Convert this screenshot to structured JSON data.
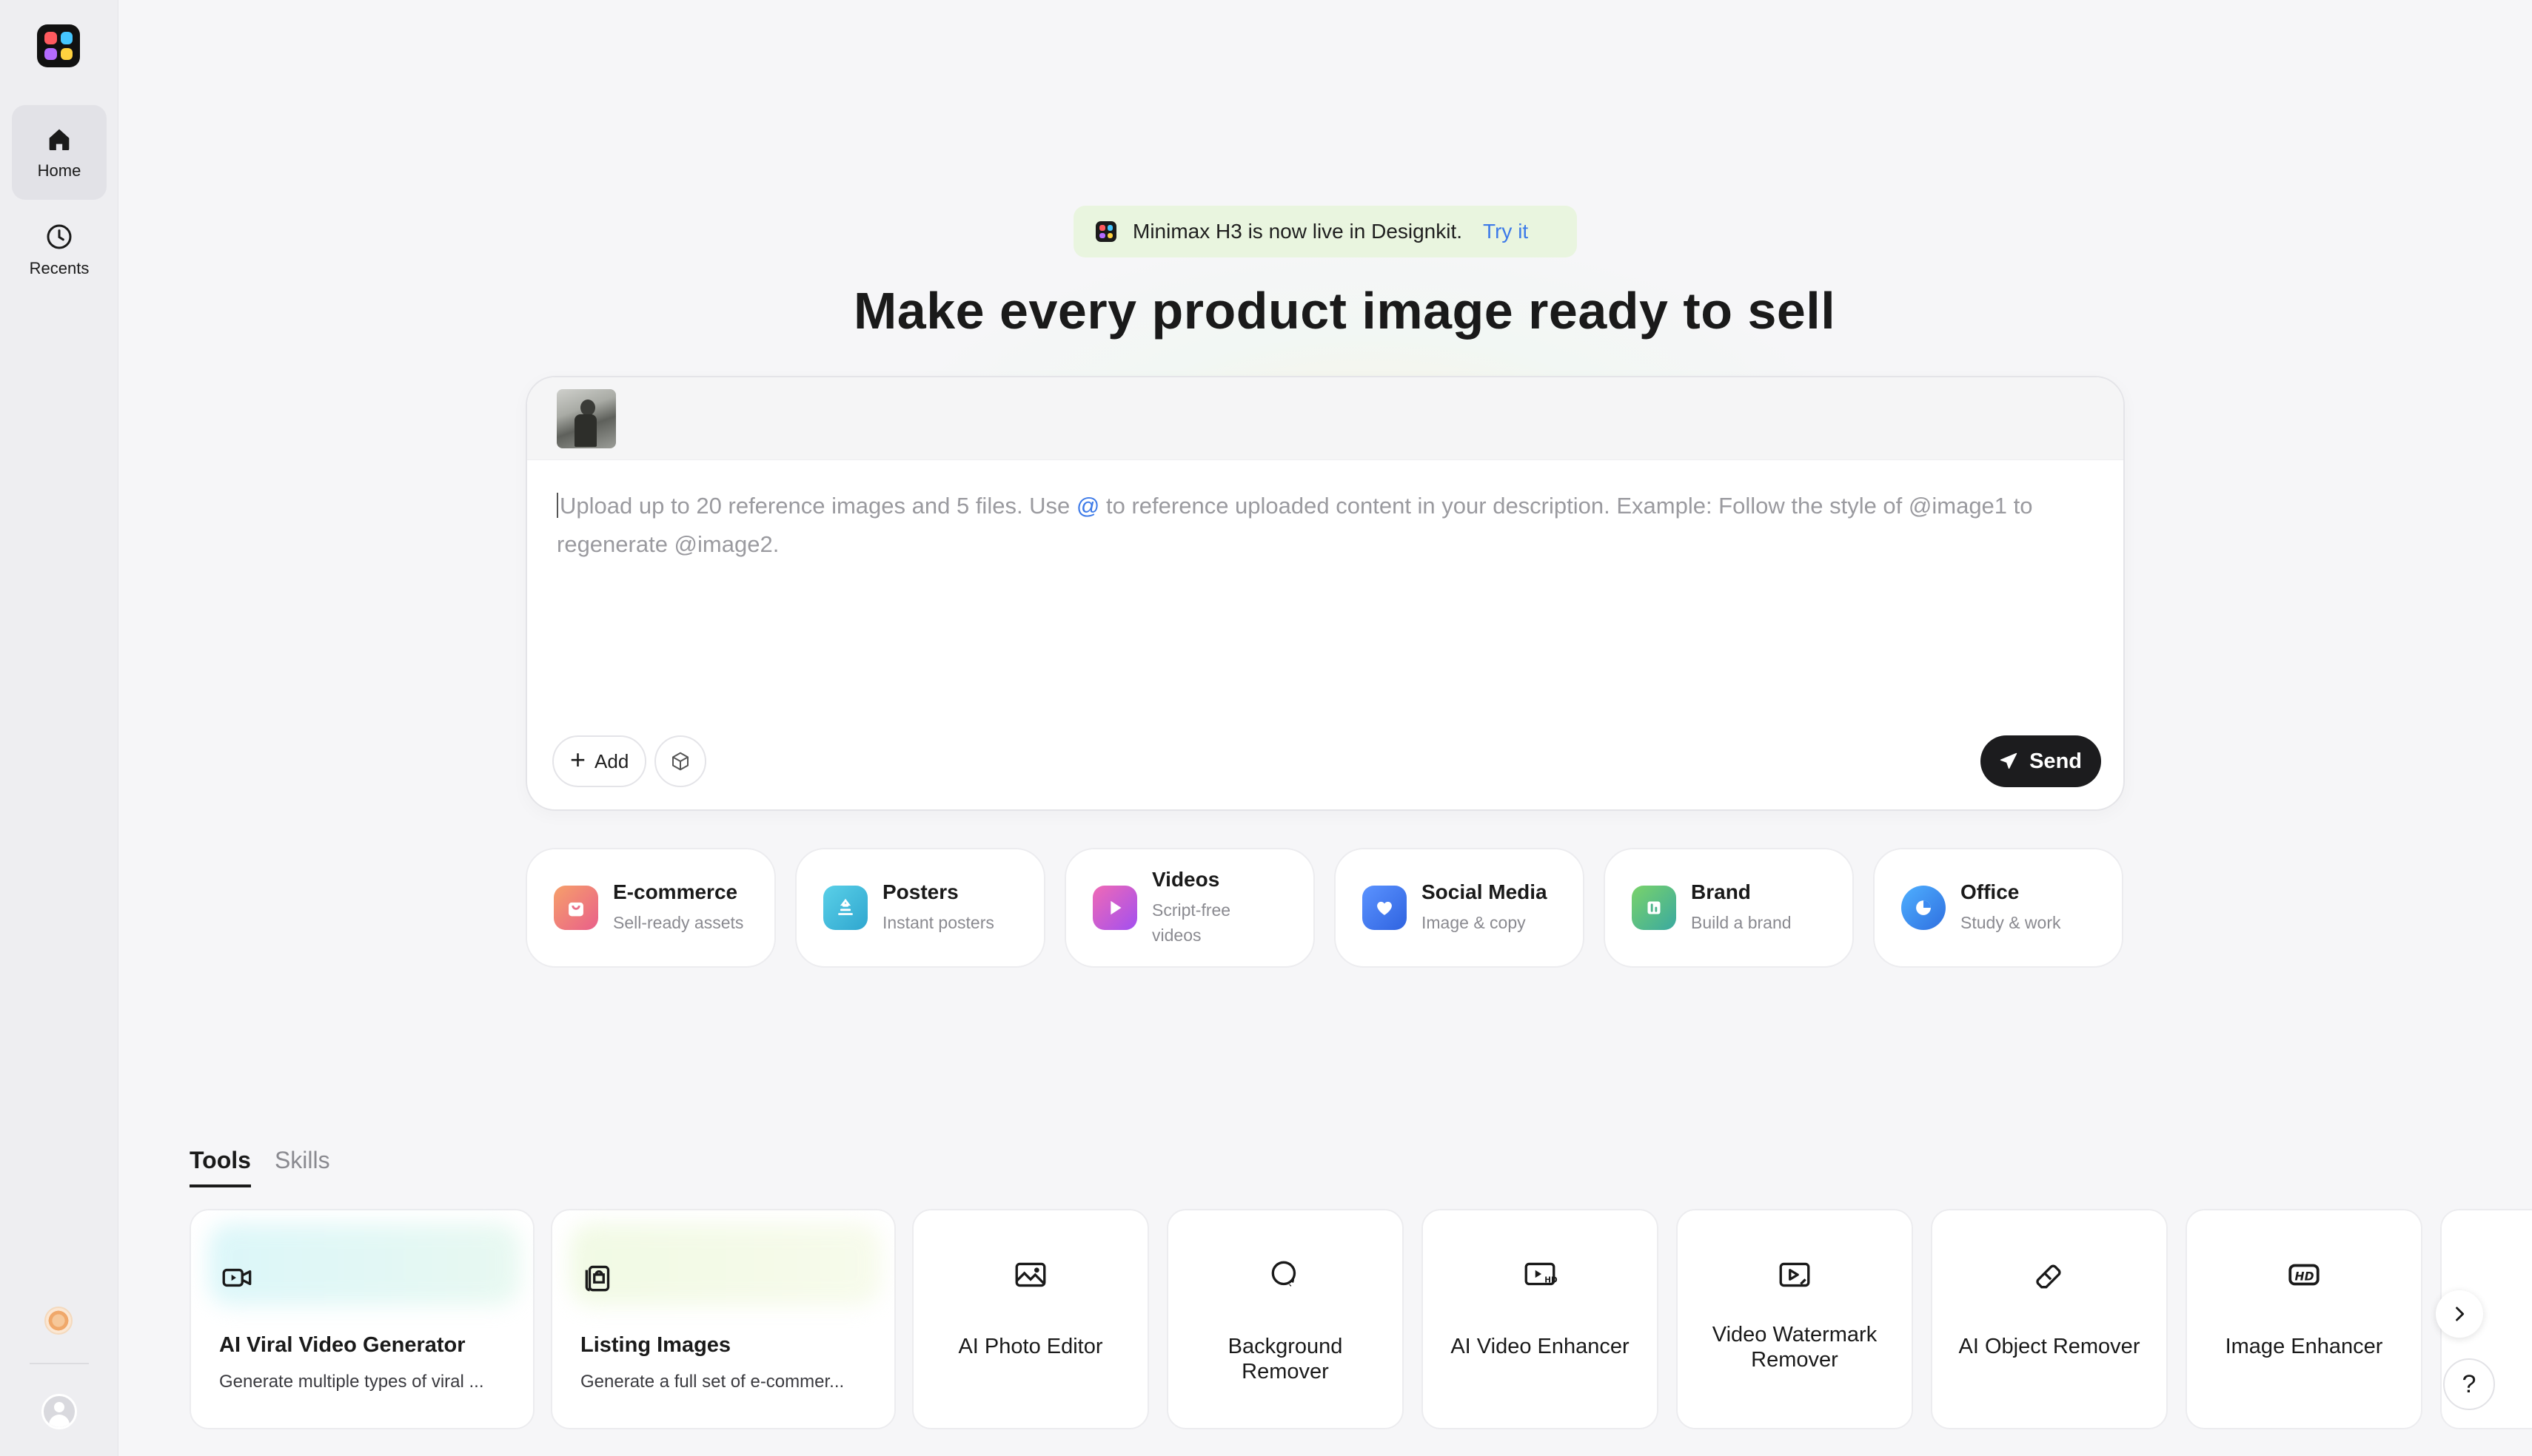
{
  "sidebar": {
    "items": [
      {
        "label": "Home",
        "icon": "home-icon",
        "active": true
      },
      {
        "label": "Recents",
        "icon": "clock-icon",
        "active": false
      }
    ]
  },
  "announcement": {
    "text": "Minimax H3 is now live in Designkit.",
    "link": "Try it"
  },
  "headline": "Make every product image ready to sell",
  "composer": {
    "placeholder_before_at": "Upload up to 20 reference images and 5 files. Use ",
    "at_symbol": "@",
    "placeholder_after_at": " to reference uploaded content in your description. Example: Follow the style of @image1 to regenerate @image2.",
    "add_label": "Add",
    "send_label": "Send"
  },
  "categories": [
    {
      "title": "E-commerce",
      "subtitle": "Sell-ready assets",
      "icon": "shopping-bag-icon",
      "color": "#f08a5d"
    },
    {
      "title": "Posters",
      "subtitle": "Instant posters",
      "icon": "poster-icon",
      "color": "#36b8d6"
    },
    {
      "title": "Videos",
      "subtitle": "Script-free videos",
      "icon": "play-icon",
      "color": "#d45ad6"
    },
    {
      "title": "Social Media",
      "subtitle": "Image & copy",
      "icon": "heart-chat-icon",
      "color": "#3d7ae8"
    },
    {
      "title": "Brand",
      "subtitle": "Build a brand",
      "icon": "brand-icon",
      "color": "#5cc070"
    },
    {
      "title": "Office",
      "subtitle": "Study & work",
      "icon": "pie-chart-icon",
      "color": "#2f8fe8"
    }
  ],
  "tabs": {
    "tools": "Tools",
    "skills": "Skills"
  },
  "tools": [
    {
      "title": "AI Viral Video Generator",
      "subtitle": "Generate multiple types of viral ...",
      "icon": "video-camera-icon"
    },
    {
      "title": "Listing Images",
      "subtitle": "Generate a full set of e-commer...",
      "icon": "listing-images-icon"
    },
    {
      "title": "AI Photo Editor",
      "icon": "photo-edit-icon"
    },
    {
      "title": "Background Remover",
      "icon": "background-remove-icon"
    },
    {
      "title": "AI Video Enhancer",
      "icon": "video-hd-icon"
    },
    {
      "title": "Video Watermark Remover",
      "icon": "video-watermark-icon"
    },
    {
      "title": "AI Object Remover",
      "icon": "eraser-icon"
    },
    {
      "title": "Image Enhancer",
      "icon": "hd-badge-icon"
    }
  ],
  "help_label": "?"
}
